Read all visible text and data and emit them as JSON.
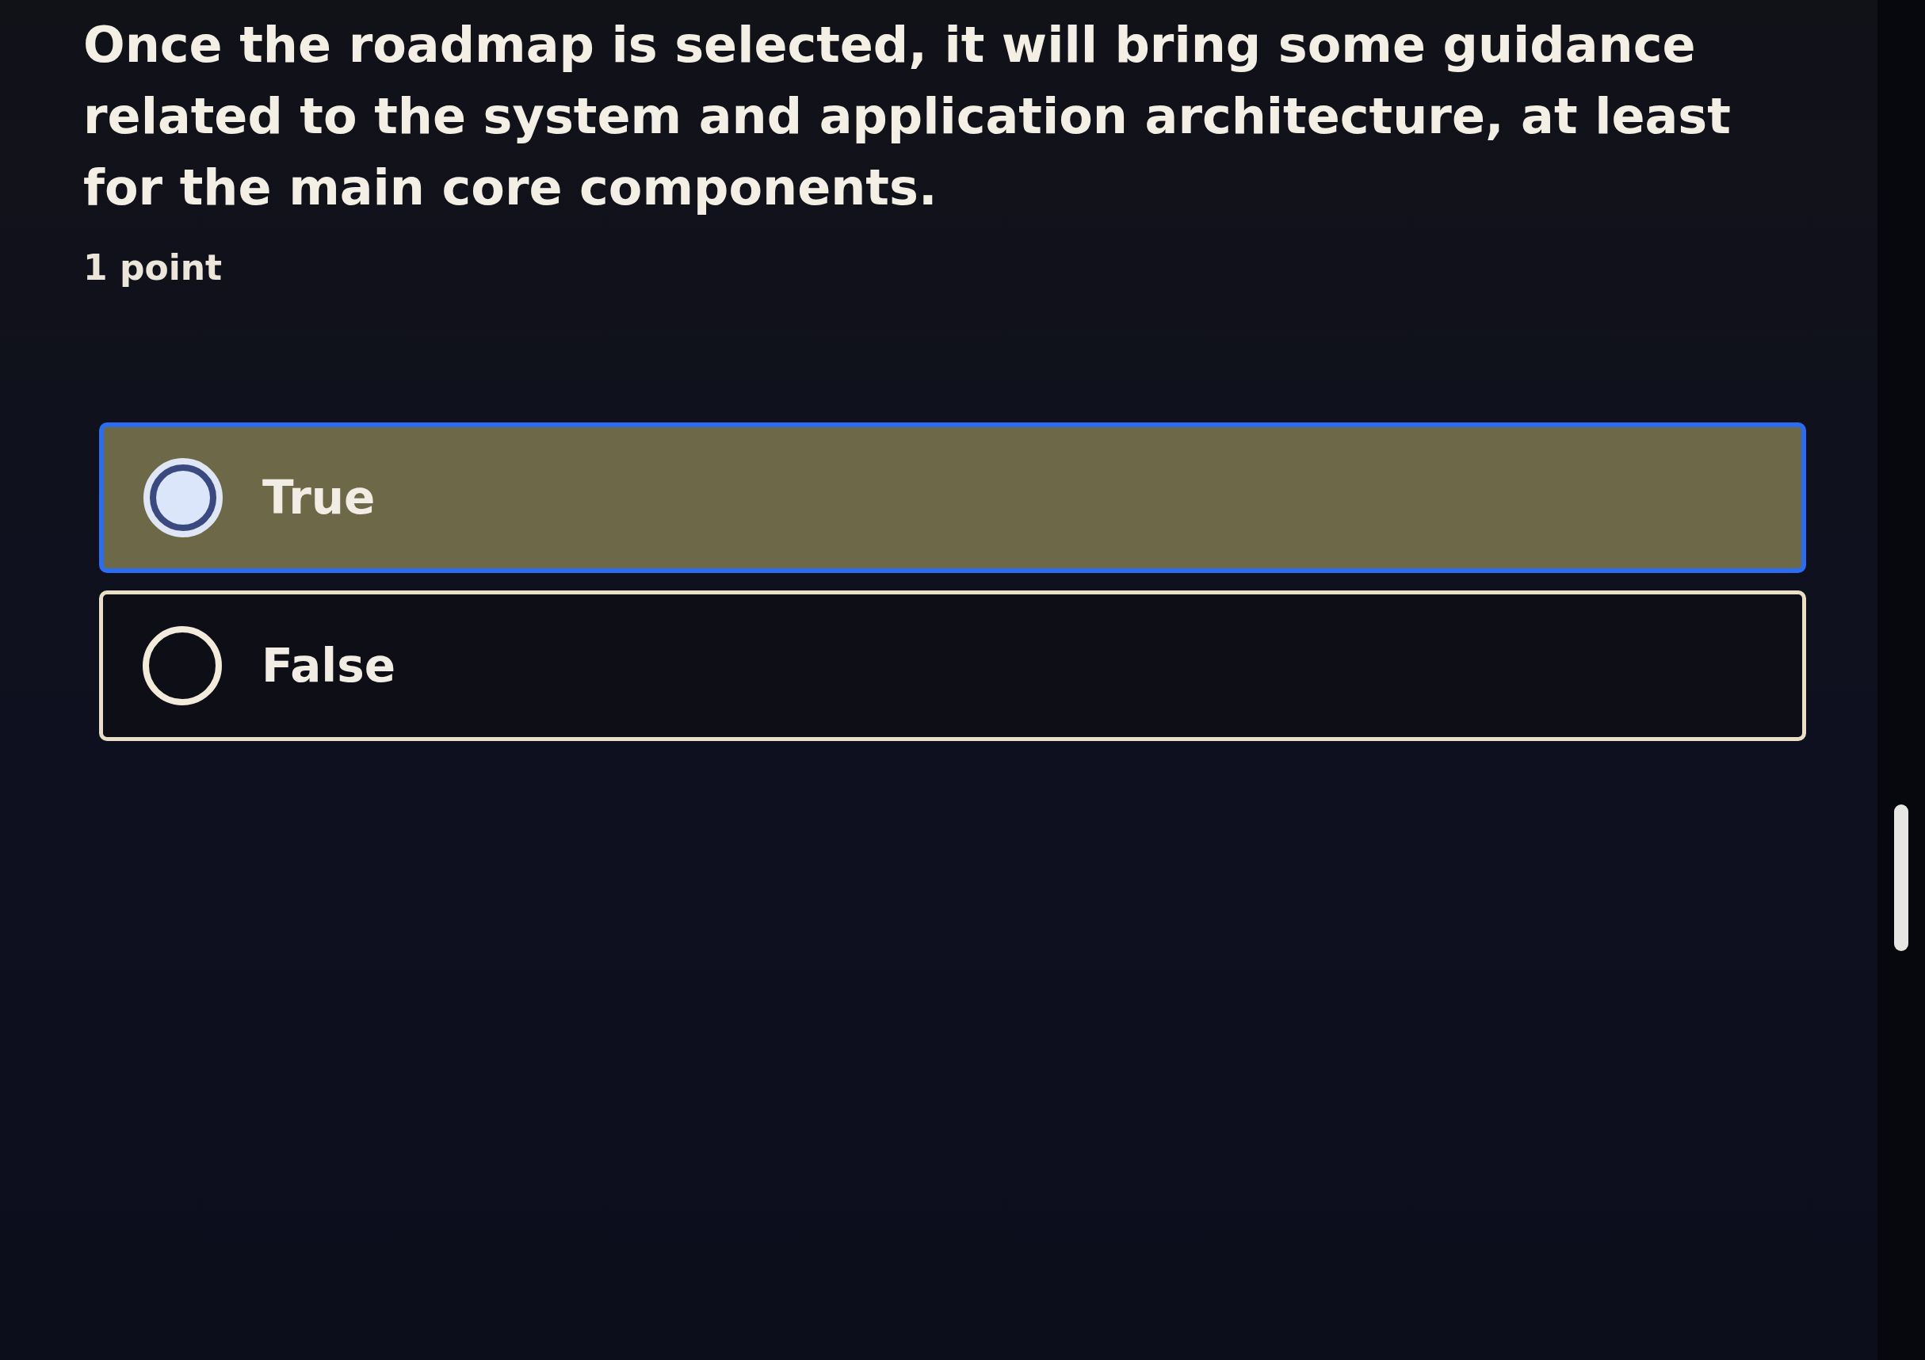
{
  "question": {
    "text": "Once the roadmap is selected, it will bring some guidance related to the system and application architecture, at least for the main core components.",
    "points": "1 point"
  },
  "options": [
    {
      "label": "True",
      "selected": true
    },
    {
      "label": "False",
      "selected": false
    }
  ]
}
